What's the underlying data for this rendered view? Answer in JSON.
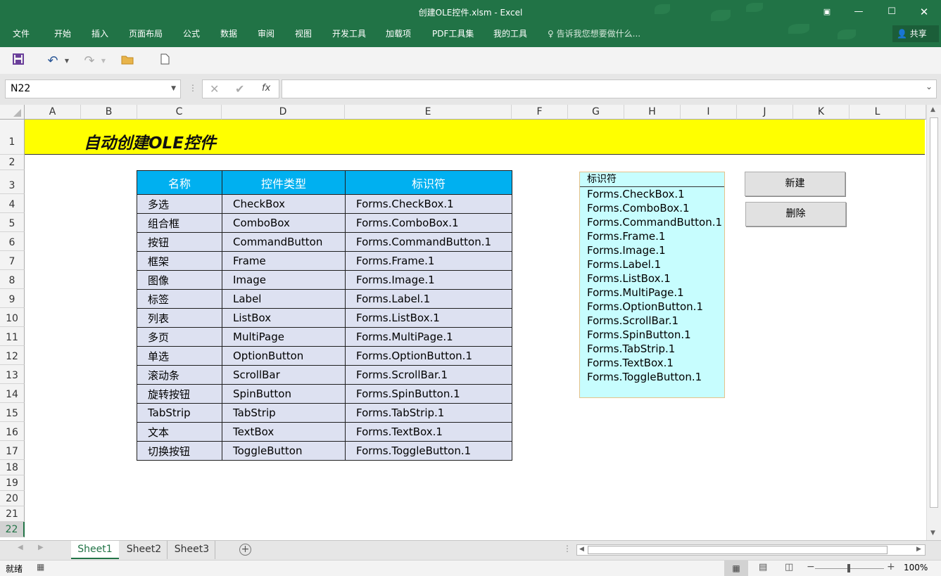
{
  "window": {
    "title": "创建OLE控件.xlsm - Excel"
  },
  "ribbon": {
    "tabs": [
      "文件",
      "开始",
      "插入",
      "页面布局",
      "公式",
      "数据",
      "审阅",
      "视图",
      "开发工具",
      "加载项",
      "PDF工具集",
      "我的工具"
    ],
    "tell_me": "告诉我您想要做什么...",
    "share": "共享"
  },
  "formula_bar": {
    "name_box": "N22",
    "formula": "",
    "fx": "fx"
  },
  "columns": [
    "A",
    "B",
    "C",
    "D",
    "E",
    "F",
    "G",
    "H",
    "I",
    "J",
    "K",
    "L"
  ],
  "rows": [
    "1",
    "2",
    "3",
    "4",
    "5",
    "6",
    "7",
    "8",
    "9",
    "10",
    "11",
    "12",
    "13",
    "14",
    "15",
    "16",
    "17",
    "18",
    "19",
    "20",
    "21",
    "22"
  ],
  "sheet": {
    "banner_title": "自动创建OLE控件",
    "table": {
      "headers": [
        "名称",
        "控件类型",
        "标识符"
      ],
      "rows": [
        [
          "多选",
          "CheckBox",
          "Forms.CheckBox.1"
        ],
        [
          "组合框",
          "ComboBox",
          "Forms.ComboBox.1"
        ],
        [
          "按钮",
          "CommandButton",
          "Forms.CommandButton.1"
        ],
        [
          "框架",
          "Frame",
          "Forms.Frame.1"
        ],
        [
          "图像",
          "Image",
          "Forms.Image.1"
        ],
        [
          "标签",
          "Label",
          "Forms.Label.1"
        ],
        [
          "列表",
          "ListBox",
          "Forms.ListBox.1"
        ],
        [
          "多页",
          "MultiPage",
          "Forms.MultiPage.1"
        ],
        [
          "单选",
          "OptionButton",
          "Forms.OptionButton.1"
        ],
        [
          "滚动条",
          "ScrollBar",
          "Forms.ScrollBar.1"
        ],
        [
          "旋转按钮",
          "SpinButton",
          "Forms.SpinButton.1"
        ],
        [
          "TabStrip",
          "TabStrip",
          "Forms.TabStrip.1"
        ],
        [
          "文本",
          "TextBox",
          "Forms.TextBox.1"
        ],
        [
          "切换按钮",
          "ToggleButton",
          "Forms.ToggleButton.1"
        ]
      ]
    },
    "listbox": {
      "header": "标识符",
      "items": [
        "Forms.CheckBox.1",
        "Forms.ComboBox.1",
        "Forms.CommandButton.1",
        "Forms.Frame.1",
        "Forms.Image.1",
        "Forms.Label.1",
        "Forms.ListBox.1",
        "Forms.MultiPage.1",
        "Forms.OptionButton.1",
        "Forms.ScrollBar.1",
        "Forms.SpinButton.1",
        "Forms.TabStrip.1",
        "Forms.TextBox.1",
        "Forms.ToggleButton.1"
      ]
    },
    "buttons": {
      "new": "新建",
      "delete": "删除"
    }
  },
  "sheet_tabs": [
    "Sheet1",
    "Sheet2",
    "Sheet3"
  ],
  "active_sheet": "Sheet1",
  "status": {
    "ready": "就绪",
    "zoom": "100%"
  },
  "colors": {
    "excel_green": "#217346",
    "banner_yellow": "#ffff00",
    "header_blue": "#00b0f0",
    "row_fill": "#dde1f1",
    "listbox_fill": "#c7fdfe"
  }
}
